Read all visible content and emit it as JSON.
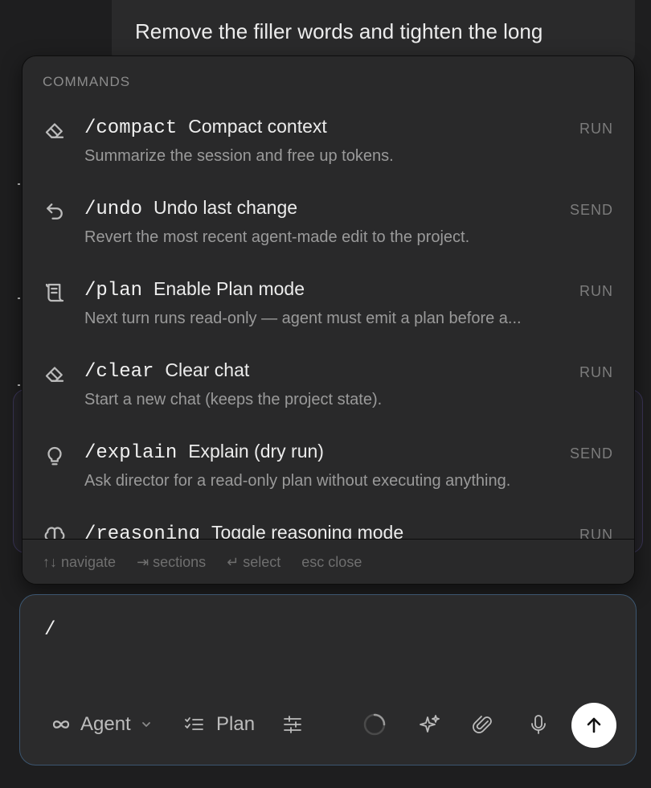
{
  "background": {
    "message_text": "Remove the filler words and tighten the long"
  },
  "menu": {
    "heading": "COMMANDS",
    "items": [
      {
        "icon": "eraser-icon",
        "command": "/compact",
        "title": "Compact context",
        "description": "Summarize the session and free up tokens.",
        "action": "RUN"
      },
      {
        "icon": "undo-icon",
        "command": "/undo",
        "title": "Undo last change",
        "description": "Revert the most recent agent-made edit to the project.",
        "action": "SEND"
      },
      {
        "icon": "scroll-icon",
        "command": "/plan",
        "title": "Enable Plan mode",
        "description": "Next turn runs read-only — agent must emit a plan before a...",
        "action": "RUN"
      },
      {
        "icon": "eraser-icon",
        "command": "/clear",
        "title": "Clear chat",
        "description": "Start a new chat (keeps the project state).",
        "action": "RUN"
      },
      {
        "icon": "lightbulb-icon",
        "command": "/explain",
        "title": "Explain (dry run)",
        "description": "Ask director for a read-only plan without executing anything.",
        "action": "SEND"
      },
      {
        "icon": "brain-icon",
        "command": "/reasoning",
        "title": "Toggle reasoning mode",
        "description": "",
        "action": "RUN"
      }
    ],
    "footer": {
      "navigate": "↑↓ navigate",
      "sections": "⇥ sections",
      "select": "↵ select",
      "close": "esc close"
    }
  },
  "composer": {
    "input_value": "/",
    "mode_label": "Agent",
    "plan_label": "Plan"
  },
  "colors": {
    "background": "#1e1e1f",
    "menu_background": "#29292a",
    "composer_border": "#3c5670",
    "send_button": "#ffffff"
  }
}
